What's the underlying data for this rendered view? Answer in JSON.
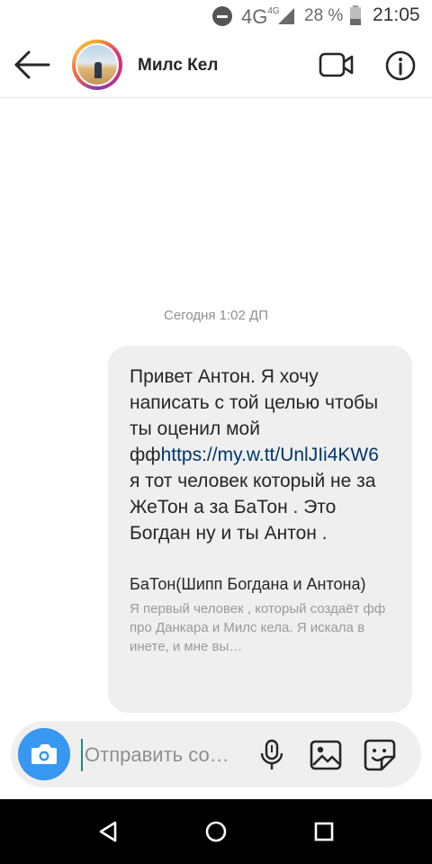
{
  "status_bar": {
    "network": "4G",
    "network_sup": "4G",
    "battery": "28 %",
    "time": "21:05"
  },
  "header": {
    "contact_name": "Милс Кел",
    "icons": [
      "back-arrow-icon",
      "video-camera-icon",
      "info-icon"
    ]
  },
  "conversation": {
    "timestamp": "Сегодня 1:02 ДП",
    "message": {
      "text_before": "Привет Антон. Я хочу написать с той целью чтобы ты оценил мой фф",
      "link": "https://my.w.tt/UnlJIi4KW6",
      "text_after": " я тот человек который не за ЖеТон а за БаТон . Это Богдан ну и ты  Антон .",
      "preview_title": "БаТон(Шипп Богдана и Антона)",
      "preview_desc": "Я первый человек , который создаёт фф про Данкара и Милс кела. Я искала в инете, и мне вы…"
    }
  },
  "composer": {
    "placeholder": "Отправить со…",
    "icons": [
      "camera-icon",
      "microphone-icon",
      "gallery-icon",
      "sticker-icon"
    ],
    "accent_color": "#3897f0"
  },
  "navbar": {
    "icons": [
      "nav-back-icon",
      "nav-home-icon",
      "nav-recent-icon"
    ]
  }
}
